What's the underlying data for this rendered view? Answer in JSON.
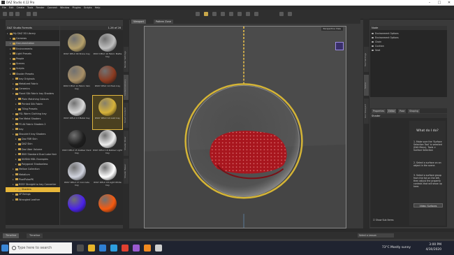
{
  "window": {
    "title": "DAZ Studio 4.12 Pro"
  },
  "menubar": [
    "File",
    "Edit",
    "Create",
    "Tools",
    "Render",
    "Connect",
    "Window",
    "PlugIns",
    "Scripts",
    "Help"
  ],
  "left_tabs": {
    "top": "Smart Content",
    "active": "Content Library"
  },
  "tree": {
    "header": "DAZ Studio Formats",
    "items": [
      {
        "label": "My DAZ 3D Library",
        "depth": 0
      },
      {
        "label": "Cameras",
        "depth": 1
      },
      {
        "label": "Documentation",
        "depth": 1,
        "selected": true
      },
      {
        "label": "Environments",
        "depth": 1
      },
      {
        "label": "Light Presets",
        "depth": 1
      },
      {
        "label": "People",
        "depth": 1
      },
      {
        "label": "Scenes",
        "depth": 1
      },
      {
        "label": "Scripts",
        "depth": 1
      },
      {
        "label": "Shader Presets",
        "depth": 1
      },
      {
        "label": "Iray Originals",
        "depth": 2
      },
      {
        "label": "Metalized Fabric",
        "depth": 2
      },
      {
        "label": "Ceramics",
        "depth": 2
      },
      {
        "label": "Floral Silk Fabric Iray Shaders",
        "depth": 2
      },
      {
        "label": "Plain Matching Colours",
        "depth": 3
      },
      {
        "label": "Printed Silk Fabric",
        "depth": 3
      },
      {
        "label": "Tiling Presets",
        "depth": 3
      },
      {
        "label": "FSL Warm Clothing Iray",
        "depth": 2
      },
      {
        "label": "Fire Metal Shaders",
        "depth": 2
      },
      {
        "label": "FS All Fabric Shaders 2",
        "depth": 2
      },
      {
        "label": "Iray",
        "depth": 2
      },
      {
        "label": "Shouldn't Iray Shaders",
        "depth": 2
      },
      {
        "label": "Daz FBR Skin",
        "depth": 3
      },
      {
        "label": "DAZ Skin",
        "depth": 3
      },
      {
        "label": "Daz Uber Volume",
        "depth": 3
      },
      {
        "label": "IRAY Standard Dual Lobe Hair",
        "depth": 3
      },
      {
        "label": "NVIDIA MDL Examples",
        "depth": 3
      },
      {
        "label": "Polygonal Shadowless",
        "depth": 3
      },
      {
        "label": "Mellow Collection",
        "depth": 2
      },
      {
        "label": "Metallum",
        "depth": 2
      },
      {
        "label": "PixelPulsePK",
        "depth": 2
      },
      {
        "label": "RSSY Straight to Iray Converter",
        "depth": 2
      },
      {
        "label": "Shaders",
        "depth": 3,
        "highlight": true
      },
      {
        "label": "SP Beings",
        "depth": 2
      },
      {
        "label": "Wrangled Leather",
        "depth": 2
      }
    ]
  },
  "content": {
    "count": "1-26 of 26",
    "tiles": [
      {
        "label": "RSSY DELX 09 Stone Iray",
        "color": "#b5a06a"
      },
      {
        "label": "RSSY DELX 10 Fabric Matte Iray",
        "color": "#bfbfbf"
      },
      {
        "label": "RSSY DELX 11 Fabric Skin Iray",
        "color": "#a88f66"
      },
      {
        "label": "RSSY DELX 12 Plain Iray",
        "color": "#8a3a20"
      },
      {
        "label": "RSSY DELX 13 Metal Iray",
        "color": "#d8d8d8"
      },
      {
        "label": "RSSY DELX 14 Gold Iray",
        "color": "#d6b23a",
        "selected": true
      },
      {
        "label": "RSSY DELX 15 Rubber Dark Iray",
        "color": "#1e1e1e"
      },
      {
        "label": "RSSY DELX 16 Rubber Light Iray",
        "color": "#eeeeee"
      },
      {
        "label": "RSSY DELX 17 Concrete Iray",
        "color": "#d0d3de"
      },
      {
        "label": "RSSY DELX 18 Light White Iray",
        "color": "#ffffff"
      },
      {
        "label": "",
        "color": "#4a22e8"
      },
      {
        "label": "",
        "color": "#f55a10"
      }
    ]
  },
  "left_vtabs": [
    "Render Settings",
    "Content Library",
    "Smart Content",
    "Shader Mixer",
    "Shader Baker"
  ],
  "viewport": {
    "tabs": [
      "Viewport",
      "Pattern Zone"
    ],
    "camera": "Perspective View"
  },
  "right_vtabs": [
    "Tool Settings",
    "Scene",
    "Aux Viewport"
  ],
  "scene": {
    "items": [
      "Environment Options",
      "Environment Options",
      "Chain",
      "Cushion",
      "Seat"
    ]
  },
  "params": {
    "tabs": [
      "Properties",
      "Editor",
      "Pose",
      "Shaping"
    ],
    "search": "Shader",
    "help_title": "What do I do?",
    "steps": [
      "1. Make sure the 'Surface Selection Tool' is selected (Edit Menu), Tools > Surface Selection",
      "2. Select a surface on an object in the scene.",
      "3. Select a surface group from the list on the left, then adjust the property controls that will show up here."
    ],
    "help_button": "Video: Surfaces",
    "show_sub": "Show Sub Items"
  },
  "bottom": {
    "tabs": [
      "Timeline",
      "Timeline"
    ],
    "lesson": "Select a Lesson"
  },
  "taskbar": {
    "search_placeholder": "Type here to search",
    "weather": "73°C  Mostly sunny",
    "time": "3:00 PM",
    "date": "4/30/2020"
  },
  "colors": {
    "accent": "#e0b740",
    "chain": "#c9a84a",
    "fabric": "#b31a22"
  }
}
